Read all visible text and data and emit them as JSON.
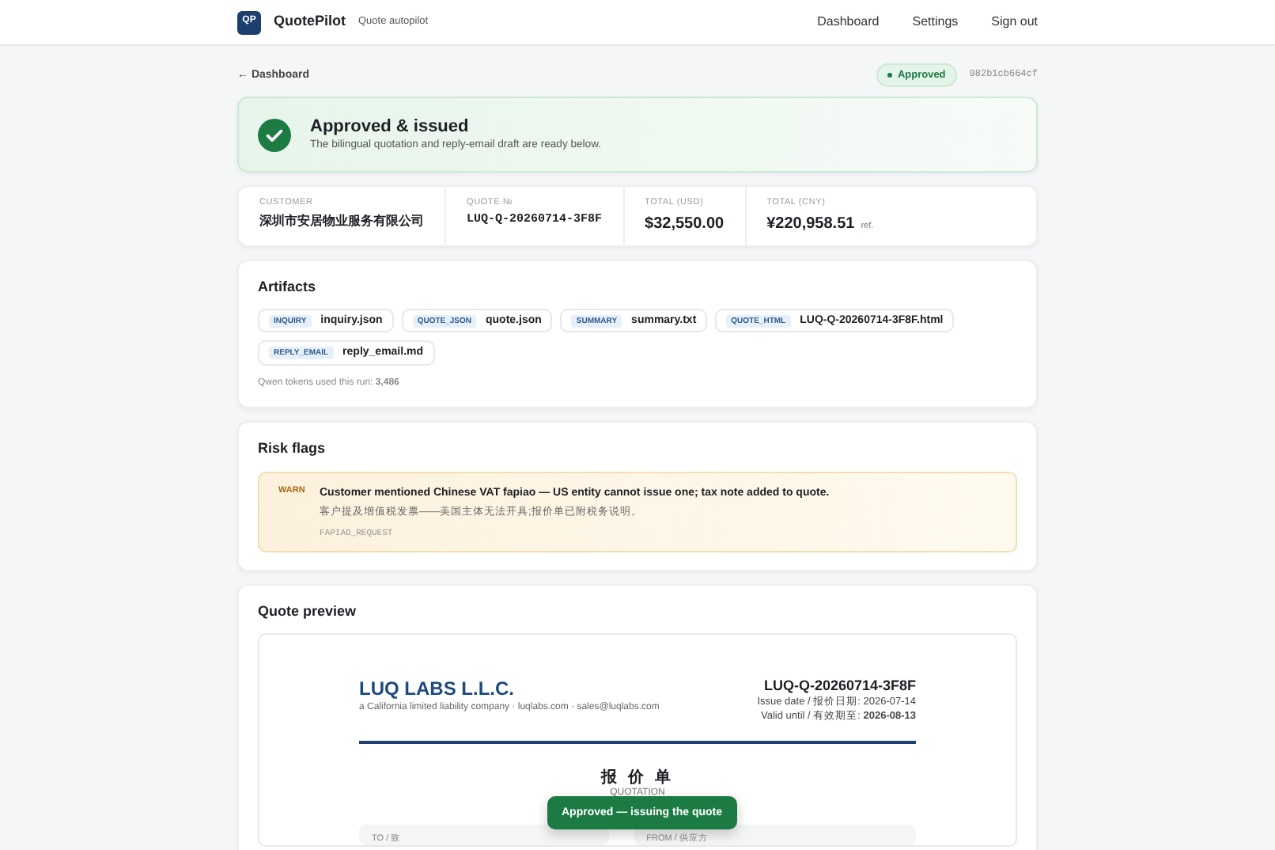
{
  "navbar": {
    "logo": "QP",
    "brand": "QuotePilot",
    "tagline": "Quote autopilot",
    "links": [
      "Dashboard",
      "Settings",
      "Sign out"
    ]
  },
  "back_link": "← Dashboard",
  "status": {
    "label": "Approved",
    "kind": "approved"
  },
  "run_id": "982b1cb664cf",
  "banner": {
    "title": "Approved & issued",
    "message": "The bilingual quotation and reply-email draft are ready below."
  },
  "summary": [
    {
      "label": "CUSTOMER",
      "value": "深圳市安居物业服务有限公司",
      "kind": "text"
    },
    {
      "label": "QUOTE №",
      "value": "LUQ-Q-20260714-3F8F",
      "kind": "mono"
    },
    {
      "label": "TOTAL (USD)",
      "value": "$32,550.00",
      "kind": "money"
    },
    {
      "label": "TOTAL (CNY)",
      "value": "¥220,958.51",
      "note": "ref.",
      "kind": "money"
    }
  ],
  "artifacts": {
    "title": "Artifacts",
    "items": [
      {
        "tag": "INQUIRY",
        "file": "inquiry.json"
      },
      {
        "tag": "QUOTE_JSON",
        "file": "quote.json"
      },
      {
        "tag": "SUMMARY",
        "file": "summary.txt"
      },
      {
        "tag": "QUOTE_HTML",
        "file": "LUQ-Q-20260714-3F8F.html"
      },
      {
        "tag": "REPLY_EMAIL",
        "file": "reply_email.md"
      }
    ],
    "tokens_label": "Qwen tokens used this run:",
    "tokens": "3,486"
  },
  "risk_flags": {
    "title": "Risk flags",
    "items": [
      {
        "level": "WARN",
        "text": "Customer mentioned Chinese VAT fapiao — US entity cannot issue one; tax note added to quote.",
        "text_zh": "客户提及增值税发票——美国主体无法开具;报价单已附税务说明。",
        "code": "FAPIAO_REQUEST"
      }
    ]
  },
  "quote_preview": {
    "title": "Quote preview",
    "company": "LUQ LABS L.L.C.",
    "company_line": "a California limited liability company · luqlabs.com · sales@luqlabs.com",
    "quote_no": "LUQ-Q-20260714-3F8F",
    "issue_label": "Issue date / 报价日期:",
    "issue_date": "2026-07-14",
    "valid_label": "Valid until / 有效期至:",
    "valid_date": "2026-08-13",
    "doc_title": "报 价 单",
    "doc_subtitle": "QUOTATION",
    "to_label": "TO / 致",
    "from_label": "FROM / 供应方"
  },
  "toast": "Approved — issuing the quote"
}
